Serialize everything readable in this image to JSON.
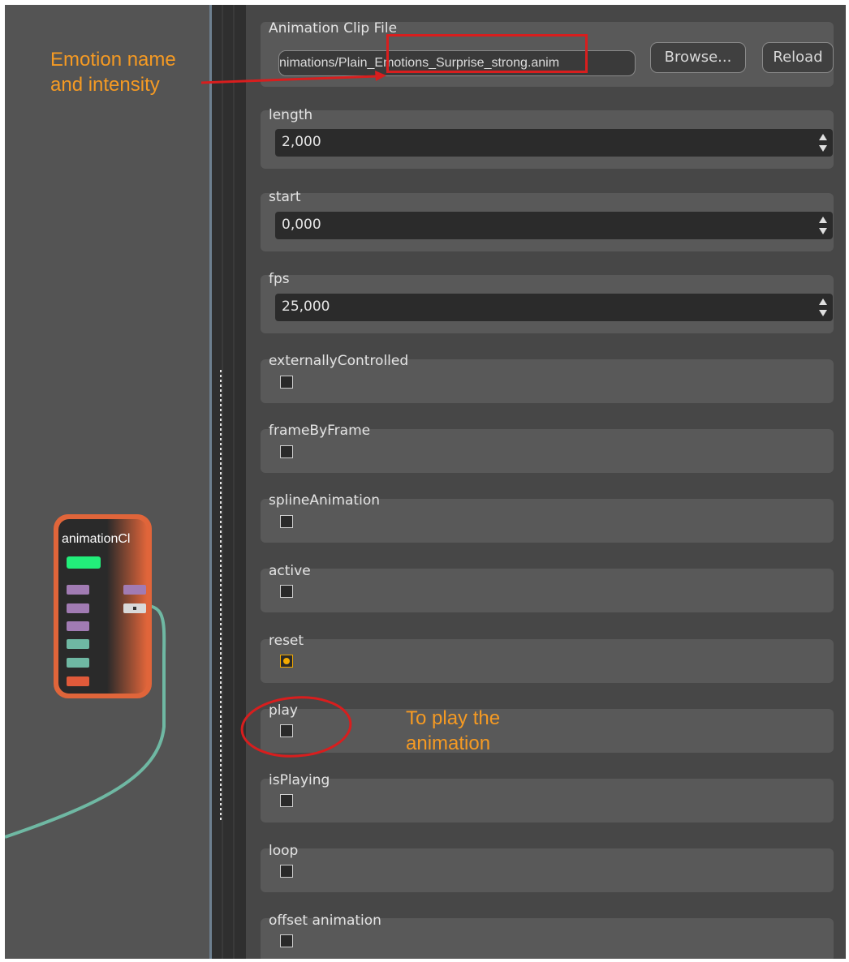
{
  "graph": {
    "node_title": "animationCl"
  },
  "properties": {
    "animation_clip_file": {
      "label": "Animation Clip File",
      "path": "nimations/Plain_Emotions_Surprise_strong.anim",
      "browse_label": "Browse...",
      "reload_label": "Reload"
    },
    "length": {
      "label": "length",
      "value": "2,000"
    },
    "start": {
      "label": "start",
      "value": "0,000"
    },
    "fps": {
      "label": "fps",
      "value": "25,000"
    },
    "checkboxes": [
      {
        "label": "externallyControlled",
        "checked": false
      },
      {
        "label": "frameByFrame",
        "checked": false
      },
      {
        "label": "splineAnimation",
        "checked": false
      },
      {
        "label": "active",
        "checked": false
      },
      {
        "label": "reset",
        "checked": true
      },
      {
        "label": "play",
        "checked": false
      },
      {
        "label": "isPlaying",
        "checked": false
      },
      {
        "label": "loop",
        "checked": false
      },
      {
        "label": "offset animation",
        "checked": false
      }
    ]
  },
  "annotations": {
    "emotion_line1": "Emotion name",
    "emotion_line2": "and intensity",
    "play_line1": "To play the",
    "play_line2": "animation"
  },
  "colors": {
    "annotation_text": "#f59a23",
    "annotation_mark": "#d81e1e",
    "node_outline": "#e0653a",
    "wire": "#6fb8a3",
    "checkbox_active": "#f2a900"
  },
  "icons": {
    "spinner": "up-down-arrows-icon"
  }
}
